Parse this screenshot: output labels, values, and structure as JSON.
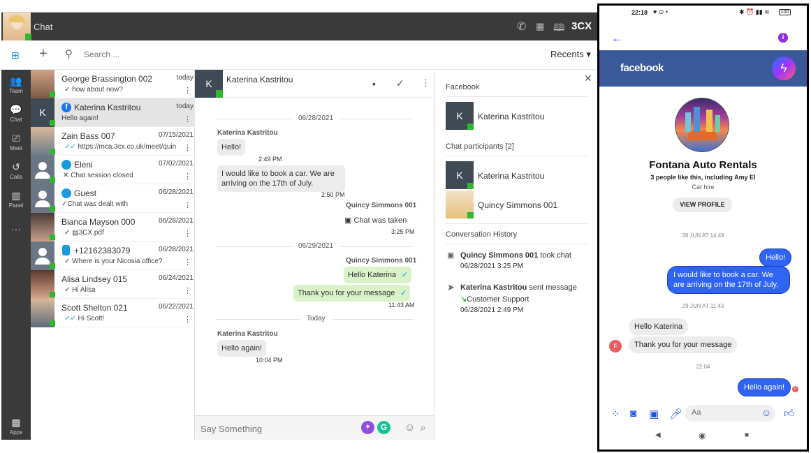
{
  "app": {
    "title": "Chat",
    "brand": "3CX",
    "search_placeholder": "Search ...",
    "recents_label": "Recents",
    "rail": [
      "Team",
      "Chat",
      "Meet",
      "Calls",
      "Panel",
      "Apps"
    ]
  },
  "chats": [
    {
      "name": "George Brassington 002",
      "date": "today",
      "msg": "how about now?",
      "tick": "✓"
    },
    {
      "name": "Katerina Kastritou",
      "date": "today",
      "msg": "Hello again!",
      "tick": ""
    },
    {
      "name": "Zain Bass 007",
      "date": "07/15/2021",
      "msg": "https://mca.3cx.co.uk/meet/quin...",
      "tick": "✓✓"
    },
    {
      "name": "Eleni",
      "date": "07/02/2021",
      "msg": "Chat session closed",
      "tick": "✕"
    },
    {
      "name": "Guest",
      "date": "06/28/2021",
      "msg": "Chat was dealt with",
      "tick": "✓"
    },
    {
      "name": "Bianca Mayson 000",
      "date": "06/28/2021",
      "msg": "3CX.pdf",
      "tick": "✓"
    },
    {
      "name": "+12162383079",
      "date": "06/28/2021",
      "msg": "Where is your Nicosia office?",
      "tick": "✓"
    },
    {
      "name": "Alisa Lindsey 015",
      "date": "06/24/2021",
      "msg": "Hi Alisa",
      "tick": "✓"
    },
    {
      "name": "Scott Shelton 021",
      "date": "06/22/2021",
      "msg": "Hi Scott!",
      "tick": "✓✓"
    }
  ],
  "conversation": {
    "contact": "Katerina Kastritou",
    "initial": "K",
    "date1": "06/28/2021",
    "sender1": "Katerina Kastritou",
    "m1": "Hello!",
    "t1": "2:49 PM",
    "m2": "I would like to book a car. We are arriving on the 17th of July.",
    "t2": "2:50 PM",
    "sender2": "Quincy Simmons 001",
    "m3": "Chat was taken",
    "t3": "3:25 PM",
    "date2": "06/29/2021",
    "sender3": "Quincy Simmons 001",
    "m4": "Hello Katerina",
    "m5": "Thank you for your message",
    "t5": "11:43 AM",
    "date3": "Today",
    "sender4": "Katerina Kastritou",
    "m6": "Hello again!",
    "t6": "10:04 PM",
    "compose_placeholder": "Say Something"
  },
  "info": {
    "facebook_label": "Facebook",
    "fb_contact": "Katerina Kastritou",
    "participants_label": "Chat participants [2]",
    "p1": "Katerina Kastritou",
    "p2": "Quincy Simmons 001",
    "history_label": "Conversation History",
    "h1_name": "Quincy Simmons 001",
    "h1_action": " took chat",
    "h1_date": "06/28/2021 3:25 PM",
    "h2_name": "Katerina Kastritou",
    "h2_action": " sent message",
    "h2_queue": "Customer Support",
    "h2_date": "06/28/2021 2:49 PM"
  },
  "phone": {
    "time": "22:18",
    "battery": "100",
    "fb_label": "facebook",
    "page_name": "Fontana Auto Rentals",
    "likes": "3 people like this, including Amy El",
    "category": "Car hire",
    "view_profile": "VIEW PROFILE",
    "stamp1": "28 JUN AT 14:49",
    "out1": "Hello!",
    "out2": "I would like to book a car. We are arriving on the 17th of July.",
    "stamp2": "29 JUN AT 11:43",
    "in1": "Hello Katerina",
    "in2": "Thank you for your message",
    "stamp3": "22:04",
    "out3": "Hello again!",
    "input_placeholder": "Aa",
    "avatar_initial": "F"
  },
  "colors": {
    "accent_blue": "#2f64f5",
    "fb_blue": "#3b5998",
    "online": "#2eb82e",
    "purple": "#8e2de2"
  }
}
